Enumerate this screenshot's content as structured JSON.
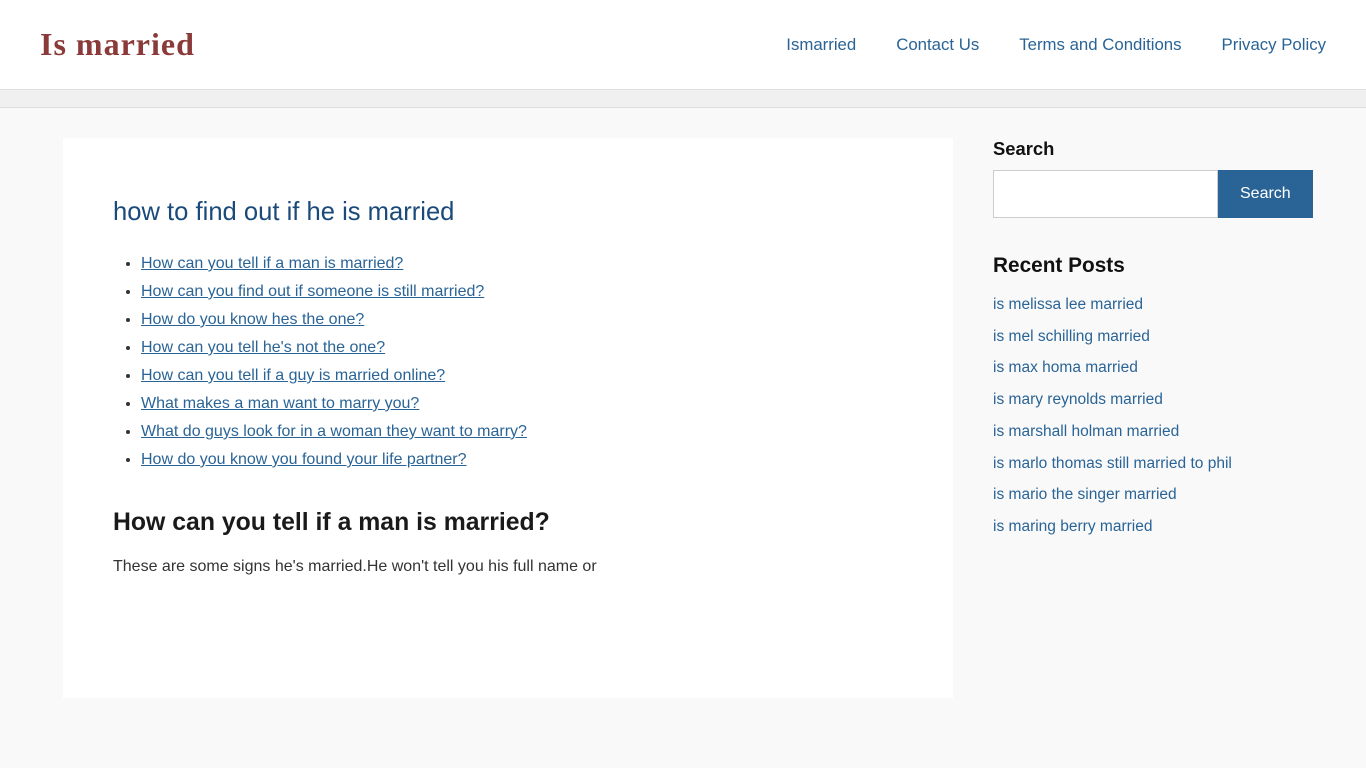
{
  "header": {
    "logo": "Is married",
    "nav": [
      {
        "label": "Ismarried",
        "href": "#"
      },
      {
        "label": "Contact Us",
        "href": "#"
      },
      {
        "label": "Terms and Conditions",
        "href": "#"
      },
      {
        "label": "Privacy Policy",
        "href": "#"
      }
    ]
  },
  "main": {
    "article_title": "how to find out if he is married",
    "toc_links": [
      "How can you tell if a man is married?",
      "How can you find out if someone is still married?",
      "How do you know hes the one?",
      "How can you tell he's not the one?",
      "How can you tell if a guy is married online?",
      "What makes a man want to marry you?",
      "What do guys look for in a woman they want to marry?",
      "How do you know you found your life partner?"
    ],
    "section_heading": "How can you tell if a man is married?",
    "section_text": "These are some signs he's married.He won't tell you his full name or"
  },
  "sidebar": {
    "search_label": "Search",
    "search_button_label": "Search",
    "search_placeholder": "",
    "recent_posts_title": "Recent Posts",
    "recent_posts": [
      "is melissa lee married",
      "is mel schilling married",
      "is max homa married",
      "is mary reynolds married",
      "is marshall holman married",
      "is marlo thomas still married to phil",
      "is mario the singer married",
      "is maring berry married"
    ]
  }
}
